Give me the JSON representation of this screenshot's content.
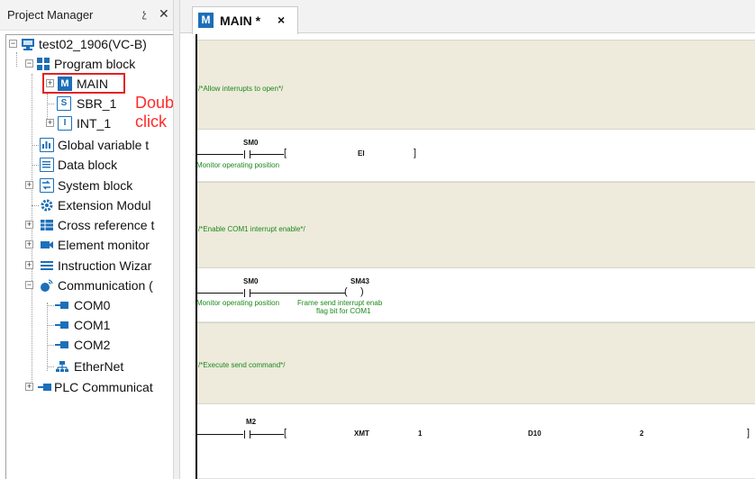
{
  "project_manager": {
    "title": "Project Manager",
    "pin_glyph": "չ",
    "close_glyph": "✕",
    "tree": {
      "root": "test02_1906(VC-B)",
      "program_block": "Program block",
      "main": "MAIN",
      "sbr": "SBR_1",
      "int": "INT_1",
      "global_var": "Global variable t",
      "data_block": "Data block",
      "system_block": "System block",
      "extension_module": "Extension Modul",
      "cross_reference": "Cross reference t",
      "element_monitor": "Element monitor",
      "instruction_wizard": "Instruction Wizar",
      "communication": "Communication (",
      "com0": "COM0",
      "com1": "COM1",
      "com2": "COM2",
      "ethernet": "EtherNet",
      "plc_comm": "PLC Communicat"
    },
    "annotation": "Double click"
  },
  "tab": {
    "icon_letter": "M",
    "label": "MAIN *",
    "close": "×"
  },
  "ladder": {
    "n1_comment": "/*Allow interrupts to open*/",
    "n1_contact": "SM0",
    "n1_contact_desc": "Monitor operating position",
    "n1_instruction": "EI",
    "n2_comment": "/*Enable COM1 interrupt enable*/",
    "n2_contact": "SM0",
    "n2_contact_desc": "Monitor operating position",
    "n2_coil": "SM43",
    "n2_coil_desc1": "Frame send interrupt enab",
    "n2_coil_desc2": "flag bit for COM1",
    "n3_comment": "/*Execute send command*/",
    "n3_contact": "M2",
    "n3_instruction": "XMT",
    "n3_op1": "1",
    "n3_op2": "D10",
    "n3_op3": "2"
  },
  "colors": {
    "accent_blue": "#1c6fb8",
    "highlight_red": "#e32323",
    "comment_green": "#1a8a1a",
    "comment_block_bg": "#eeeadc"
  }
}
